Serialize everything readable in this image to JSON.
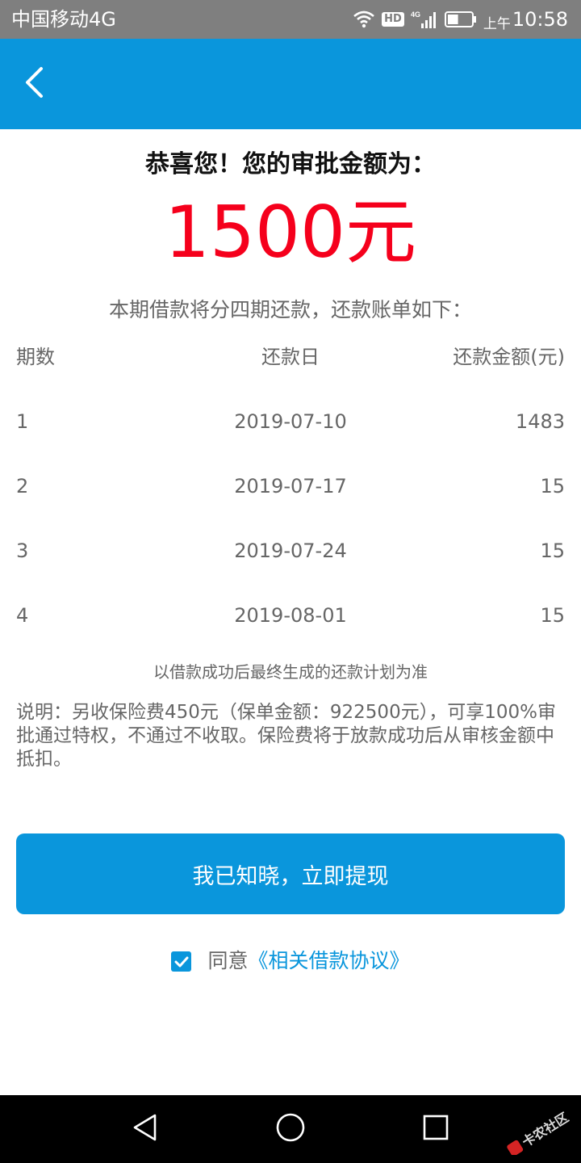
{
  "status_bar": {
    "carrier": "中国移动4G",
    "hd_badge": "HD",
    "network_label": "4G",
    "time_period": "上午",
    "time": "10:58",
    "battery_level": 0.45
  },
  "header": {
    "back_icon": "chevron-left-icon",
    "background": "#0a96dc"
  },
  "approval": {
    "headline": "恭喜您！您的审批金额为：",
    "amount": "1500元",
    "amount_color": "#f5001c",
    "plan_intro": "本期借款将分四期还款，还款账单如下："
  },
  "schedule": {
    "columns": [
      "期数",
      "还款日",
      "还款金额(元)"
    ],
    "rows": [
      [
        "1",
        "2019-07-10",
        "1483"
      ],
      [
        "2",
        "2019-07-17",
        "15"
      ],
      [
        "3",
        "2019-07-24",
        "15"
      ],
      [
        "4",
        "2019-08-01",
        "15"
      ]
    ],
    "note": "以借款成功后最终生成的还款计划为准"
  },
  "description": "说明：另收保险费450元（保单金额：922500元），可享100%审批通过特权，不通过不收取。保险费将于放款成功后从审核金额中抵扣。",
  "actions": {
    "withdraw_label": "我已知晓，立即提现",
    "agree_checked": true,
    "agree_label": "同意",
    "agreement_link": "《相关借款协议》",
    "accent_color": "#0a96dc"
  },
  "nav_bar": {
    "back_icon": "triangle-back-icon",
    "home_icon": "circle-home-icon",
    "recents_icon": "square-recents-icon",
    "watermark": "卡农社区"
  }
}
